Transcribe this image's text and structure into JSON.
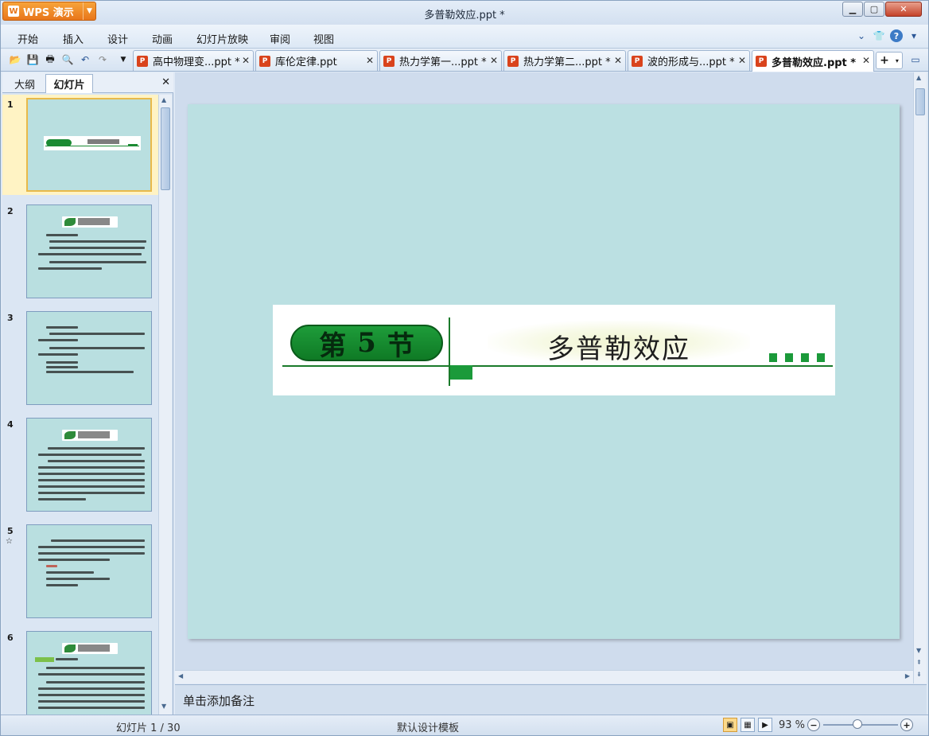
{
  "app": {
    "brand": "WPS 演示",
    "window_title": "多普勒效应.ppt *"
  },
  "menu": [
    "开始",
    "插入",
    "设计",
    "动画",
    "幻灯片放映",
    "审阅",
    "视图"
  ],
  "doc_tabs": [
    {
      "label": "高中物理变...ppt *",
      "active": false
    },
    {
      "label": "库伦定律.ppt",
      "active": false
    },
    {
      "label": "热力学第一...ppt *",
      "active": false
    },
    {
      "label": "热力学第二...ppt *",
      "active": false
    },
    {
      "label": "波的形成与...ppt *",
      "active": false
    },
    {
      "label": "多普勒效应.ppt *",
      "active": true
    }
  ],
  "panel": {
    "tab_outline": "大纲",
    "tab_slides": "幻灯片",
    "thumbnails": [
      {
        "num": "1",
        "selected": true
      },
      {
        "num": "2",
        "selected": false
      },
      {
        "num": "3",
        "selected": false
      },
      {
        "num": "4",
        "selected": false
      },
      {
        "num": "5",
        "selected": false,
        "star": "☆"
      },
      {
        "num": "6",
        "selected": false
      }
    ]
  },
  "slide": {
    "section_label_1": "第",
    "section_label_2": "5",
    "section_label_3": "节",
    "title": "多普勒效应"
  },
  "notes_placeholder": "单击添加备注",
  "status": {
    "slide_counter": "幻灯片 1 / 30",
    "template": "默认设计模板",
    "zoom": "93 %"
  },
  "colors": {
    "slide_bg": "#bbe0e2",
    "accent_green": "#1b9a3a",
    "wps_orange": "#e8761a"
  }
}
